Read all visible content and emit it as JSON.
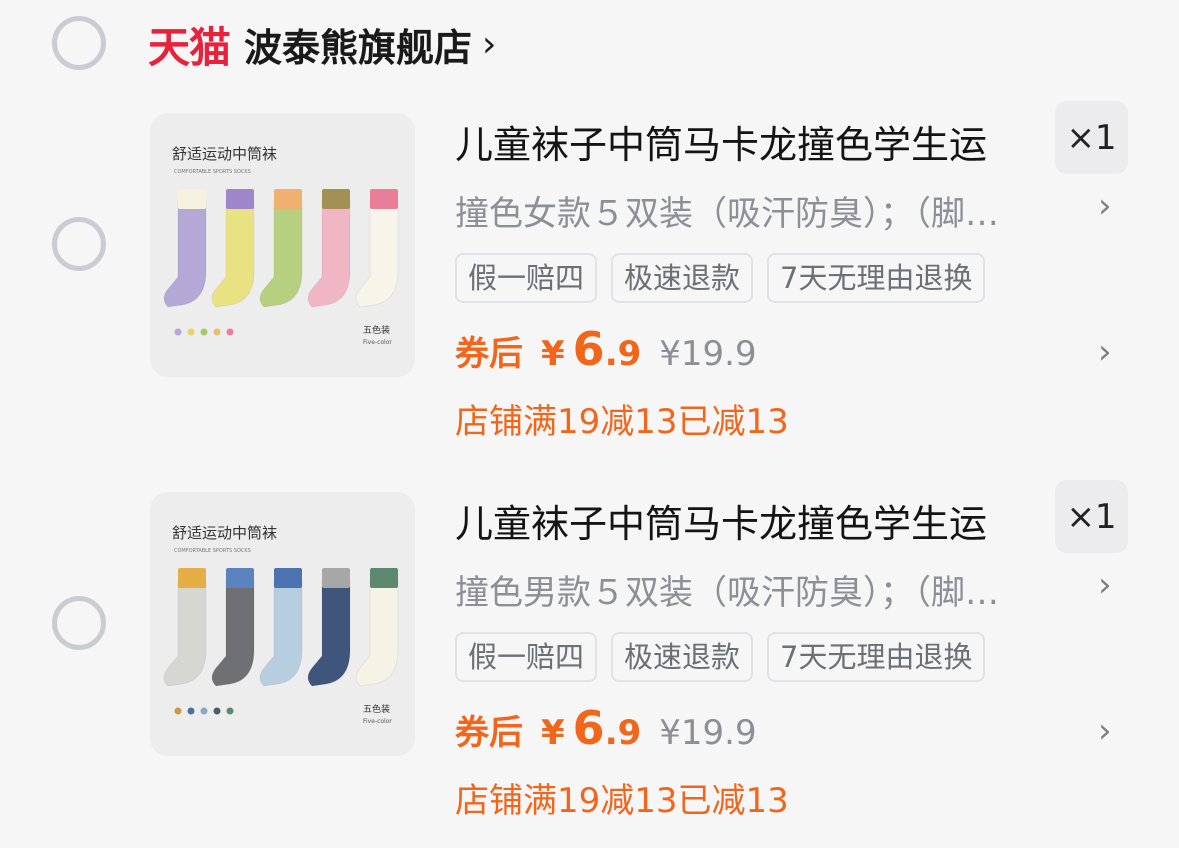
{
  "shop": {
    "logo_text": "天猫",
    "name": "波泰熊旗舰店",
    "chevron": "›"
  },
  "items": [
    {
      "title": "儿童袜子中筒马卡龙撞色学生运",
      "qty": "×1",
      "spec": "撞色女款５双装（吸汗防臭）；（脚…",
      "tags": [
        "假一赔四",
        "极速退款",
        "7天无理由退换"
      ],
      "coupon_label": "券后",
      "yen": "¥",
      "price_int": "6",
      "price_dec": ".9",
      "orig_price": "¥19.9",
      "promo": "店铺满19减13已减13",
      "thumb": {
        "heading": "舒适运动中筒袜",
        "sub": "COMFORTABLE SPORTS SOCKS",
        "count": "五色装",
        "count_en": "Five-color",
        "sock_colors": [
          "#b3a8d6",
          "#e9e283",
          "#b7d07f",
          "#f1b6c4",
          "#f7f4ea"
        ],
        "cuff_colors": [
          "#f6f1dd",
          "#9e86c8",
          "#f0b070",
          "#a29055",
          "#e87e9a"
        ],
        "dots": [
          "#b3a8d6",
          "#e9d36a",
          "#a8c66a",
          "#e4c06e",
          "#e87e9a"
        ]
      }
    },
    {
      "title": "儿童袜子中筒马卡龙撞色学生运",
      "qty": "×1",
      "spec": "撞色男款５双装（吸汗防臭）；（脚…",
      "tags": [
        "假一赔四",
        "极速退款",
        "7天无理由退换"
      ],
      "coupon_label": "券后",
      "yen": "¥",
      "price_int": "6",
      "price_dec": ".9",
      "orig_price": "¥19.9",
      "promo": "店铺满19减13已减13",
      "thumb": {
        "heading": "舒适运动中筒袜",
        "sub": "COMFORTABLE SPORTS SOCKS",
        "count": "五色装",
        "count_en": "Five-color",
        "sock_colors": [
          "#d6d6d3",
          "#6f7074",
          "#b7cde0",
          "#40557c",
          "#f5f2e6"
        ],
        "cuff_colors": [
          "#e4ae45",
          "#5b84bf",
          "#4a73b0",
          "#a7a7a7",
          "#5c8a70"
        ],
        "dots": [
          "#c79a45",
          "#4d6fa3",
          "#8da7c0",
          "#4f5a6a",
          "#5b8a72"
        ]
      }
    }
  ]
}
